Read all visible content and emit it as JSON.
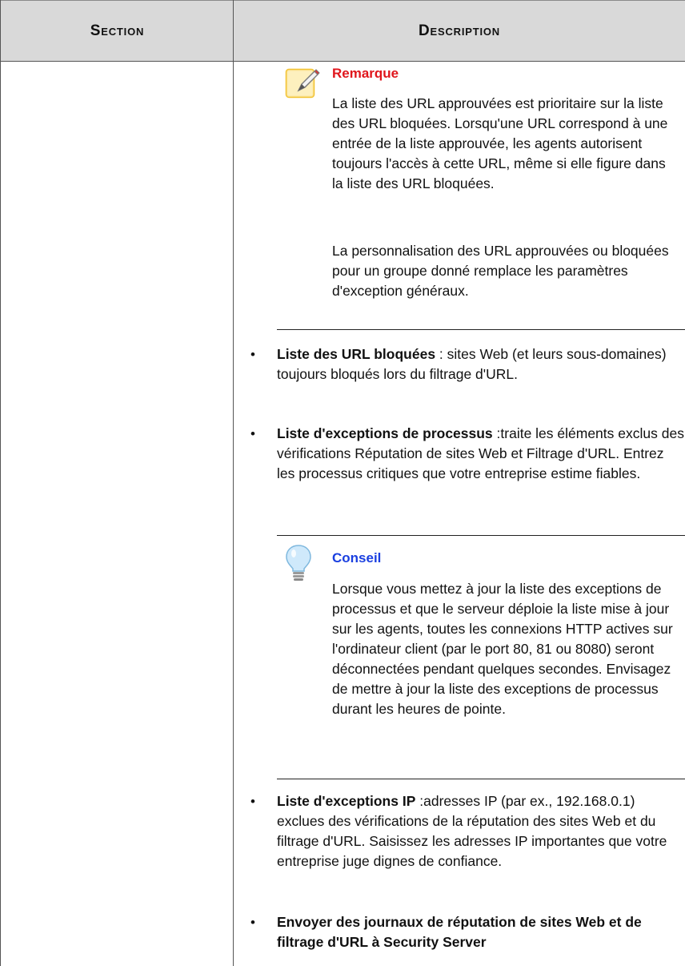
{
  "table": {
    "columns": [
      "Section",
      "Description"
    ]
  },
  "note": {
    "icon": "note-pencil-icon",
    "title": "Remarque",
    "paragraphs": [
      "La liste des URL approuvées est prioritaire sur la liste des URL bloquées. Lorsqu'une URL correspond à une entrée de la liste approuvée, les agents autorisent toujours l'accès à cette URL, même si elle figure dans la liste des URL bloquées.",
      "La personnalisation des URL approuvées ou bloquées pour un groupe donné remplace les paramètres d'exception généraux."
    ]
  },
  "items": [
    {
      "term": "Liste des URL bloquées",
      "text": " : sites Web (et leurs sous-domaines) toujours bloqués lors du filtrage d'URL."
    },
    {
      "term": "Liste d'exceptions de processus",
      "text": " :traite les éléments exclus des vérifications Réputation de sites Web et Filtrage d'URL. Entrez les processus critiques que votre entreprise estime fiables."
    },
    {
      "term": "Liste d'exceptions IP",
      "text": " :adresses IP (par ex., 192.168.0.1) exclues des vérifications de la réputation des sites Web et du filtrage d'URL. Saisissez les adresses IP importantes que votre entreprise juge dignes de confiance."
    },
    {
      "term": "Envoyer des journaux de réputation de sites Web et de filtrage d'URL à Security Server",
      "text": ""
    }
  ],
  "tip": {
    "icon": "lightbulb-icon",
    "title": "Conseil",
    "paragraph": "Lorsque vous mettez à jour la liste des exceptions de processus et que le serveur déploie la liste mise à jour sur les agents, toutes les connexions HTTP actives sur l'ordinateur client (par le port 80, 81 ou 8080) seront déconnectées pendant quelques secondes. Envisagez de mettre à jour la liste des exceptions de processus durant les heures de pointe."
  },
  "colors": {
    "header_bg": "#d9d9d9",
    "note_title": "#e0161c",
    "tip_title": "#1a3fe0",
    "note_icon": "#f2c230"
  }
}
